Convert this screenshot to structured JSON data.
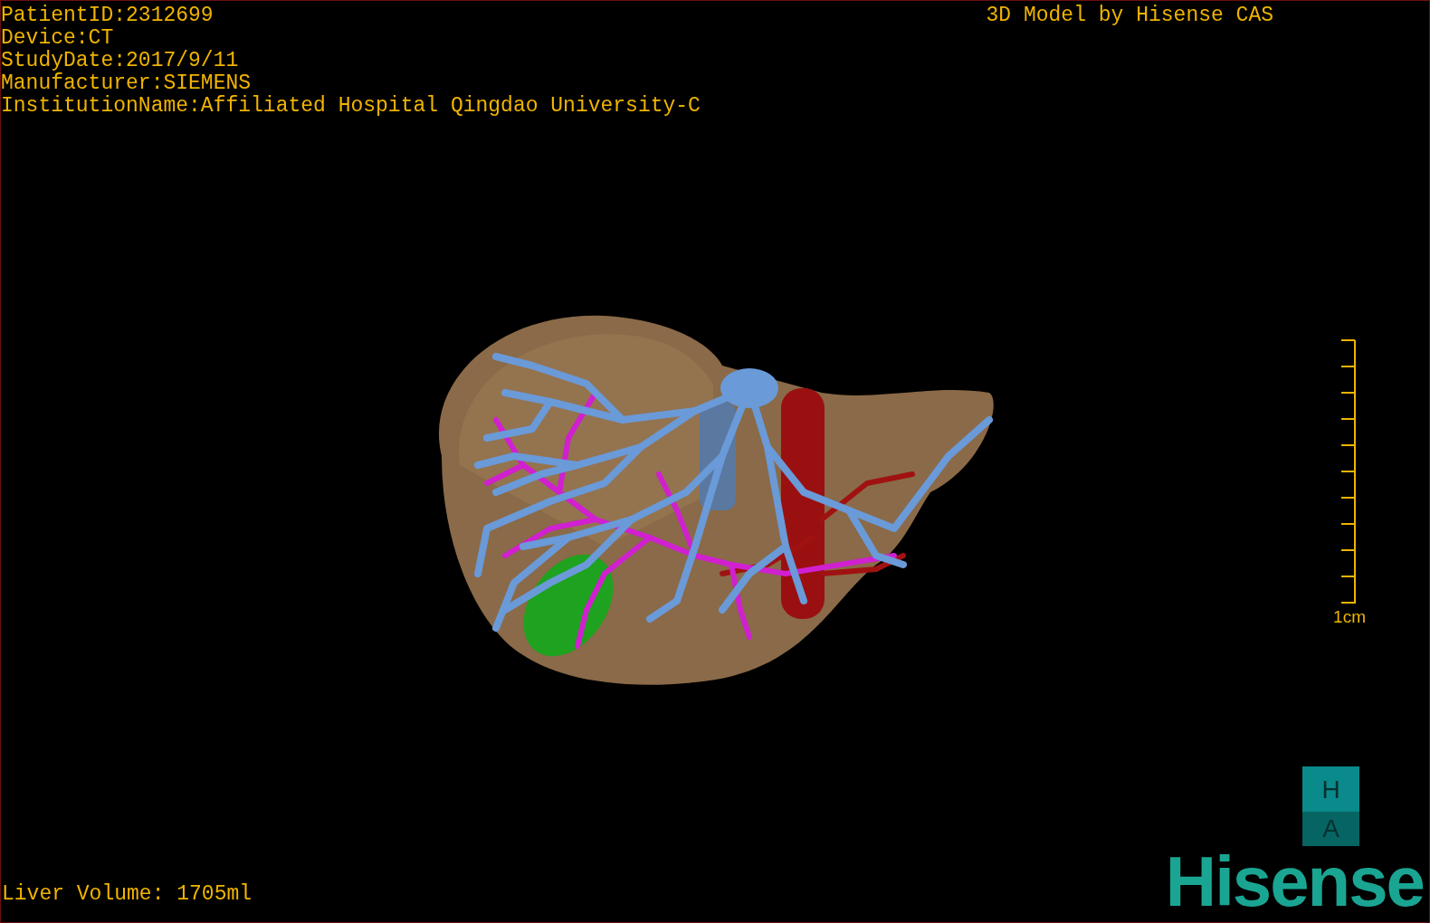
{
  "info_lines": [
    "PatientID:2312699",
    "Device:CT",
    "StudyDate:2017/9/11",
    "Manufacturer:SIEMENS",
    "InstitutionName:Affiliated Hospital Qingdao University-C"
  ],
  "model_title": "3D Model by Hisense CAS",
  "scale_label": "1cm",
  "liver_volume": "Liver Volume: 1705ml",
  "orientation": {
    "top": "H",
    "bottom": "A"
  },
  "logo": "Hisense"
}
